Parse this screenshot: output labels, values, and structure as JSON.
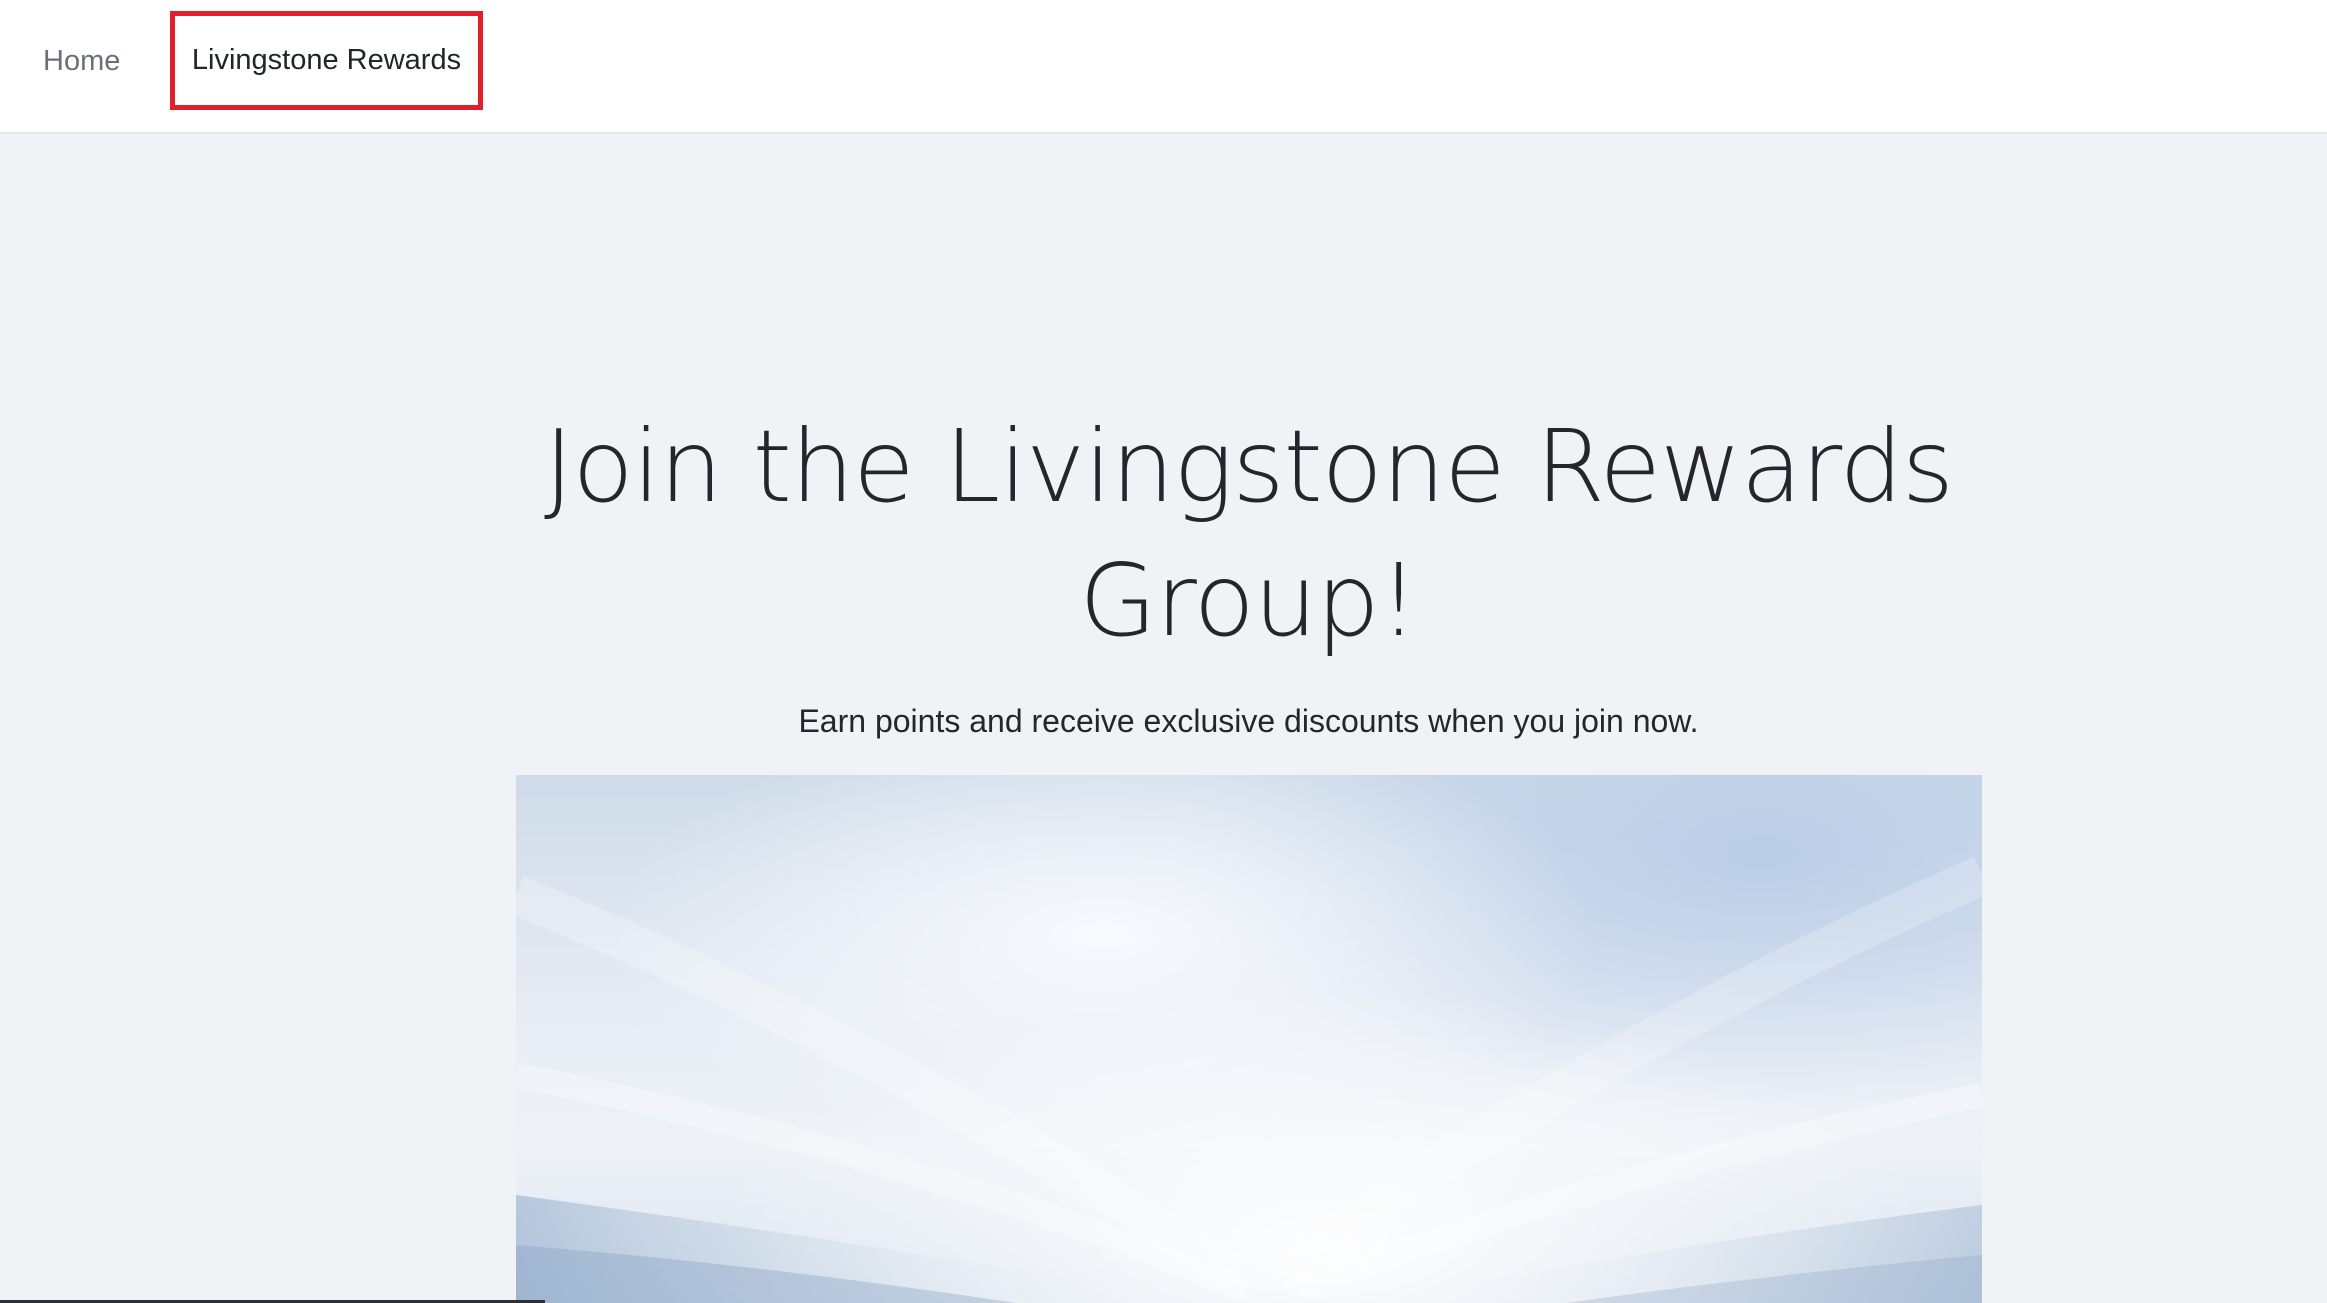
{
  "nav": {
    "home_label": "Home",
    "rewards_label": "Livingstone Rewards"
  },
  "hero": {
    "title": "Join the Livingstone Rewards Group!",
    "subtitle": "Earn points and receive exclusive discounts when you join now."
  },
  "colors": {
    "nav_highlight_border": "#e0202a",
    "page_background": "#f0f2f5",
    "text_dark": "#25262d",
    "nav_muted": "#6b6f78"
  }
}
